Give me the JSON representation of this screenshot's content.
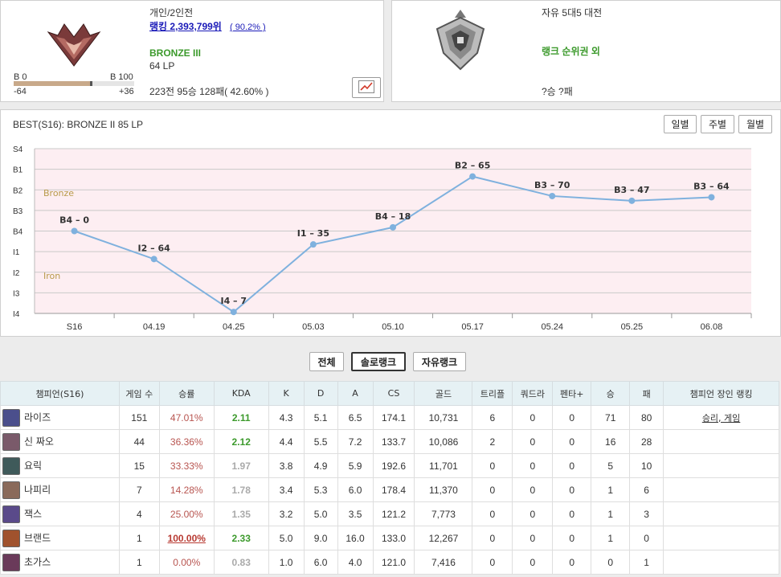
{
  "solo": {
    "queue_title": "개인/2인전",
    "ranking_text": "랭킹 2,393,799위",
    "ranking_pct": "( 90.2% )",
    "tier": "BRONZE III",
    "lp": "64 LP",
    "lp_left_label": "B 0",
    "lp_right_label": "B 100",
    "lp_min": "-64",
    "lp_max": "+36",
    "lp_progress": 0.64,
    "record": "223전 95승 128패( 42.60% )"
  },
  "flex": {
    "queue_title": "자유 5대5 대전",
    "status": "랭크 순위권 외",
    "record": "?승 ?패"
  },
  "graph": {
    "best_text": "BEST(S16): BRONZE II 85 LP",
    "period_buttons": [
      "일별",
      "주별",
      "월별"
    ],
    "bands": {
      "bronze": "Bronze",
      "iron": "Iron"
    }
  },
  "chart_data": {
    "type": "line",
    "y_ticks": [
      "S4",
      "B1",
      "B2",
      "B3",
      "B4",
      "I1",
      "I2",
      "I3",
      "I4"
    ],
    "x": [
      "S16",
      "04.19",
      "04.25",
      "05.03",
      "05.10",
      "05.17",
      "05.24",
      "05.25",
      "06.08"
    ],
    "values": [
      400,
      264,
      7,
      335,
      418,
      665,
      570,
      547,
      564
    ],
    "point_labels": [
      "B4 – 0",
      "I2 – 64",
      "I4 – 7",
      "I1 – 35",
      "B4 – 18",
      "B2 – 65",
      "B3 – 70",
      "B3 – 47",
      "B3 – 64"
    ],
    "line_color": "#7fb1de",
    "band_color": "#fdeef2"
  },
  "queue_buttons": [
    "전체",
    "솔로랭크",
    "자유랭크"
  ],
  "active_queue": "솔로랭크",
  "table": {
    "headers": [
      "챔피언(S16)",
      "게임 수",
      "승률",
      "KDA",
      "K",
      "D",
      "A",
      "CS",
      "골드",
      "트리플",
      "쿼드라",
      "펜타+",
      "승",
      "패",
      "챔피언 장인 랭킹"
    ],
    "rows": [
      {
        "name": "라이즈",
        "games": "151",
        "wr": "47.01%",
        "kda": "2.11",
        "k": "4.3",
        "d": "5.1",
        "a": "6.5",
        "cs": "174.1",
        "gold": "10,731",
        "triple": "6",
        "quadra": "0",
        "penta": "0",
        "w": "71",
        "l": "80",
        "mastery": "승리, 게임",
        "icon_color": "#4b4f8c"
      },
      {
        "name": "신 짜오",
        "games": "44",
        "wr": "36.36%",
        "kda": "2.12",
        "k": "4.4",
        "d": "5.5",
        "a": "7.2",
        "cs": "133.7",
        "gold": "10,086",
        "triple": "2",
        "quadra": "0",
        "penta": "0",
        "w": "16",
        "l": "28",
        "mastery": "",
        "icon_color": "#7a5a6a"
      },
      {
        "name": "요릭",
        "games": "15",
        "wr": "33.33%",
        "kda": "1.97",
        "k": "3.8",
        "d": "4.9",
        "a": "5.9",
        "cs": "192.6",
        "gold": "11,701",
        "triple": "0",
        "quadra": "0",
        "penta": "0",
        "w": "5",
        "l": "10",
        "mastery": "",
        "icon_color": "#3f5a5a"
      },
      {
        "name": "나피리",
        "games": "7",
        "wr": "14.28%",
        "kda": "1.78",
        "k": "3.4",
        "d": "5.3",
        "a": "6.0",
        "cs": "178.4",
        "gold": "11,370",
        "triple": "0",
        "quadra": "0",
        "penta": "0",
        "w": "1",
        "l": "6",
        "mastery": "",
        "icon_color": "#8a6a5a"
      },
      {
        "name": "잭스",
        "games": "4",
        "wr": "25.00%",
        "kda": "1.35",
        "k": "3.2",
        "d": "5.0",
        "a": "3.5",
        "cs": "121.2",
        "gold": "7,773",
        "triple": "0",
        "quadra": "0",
        "penta": "0",
        "w": "1",
        "l": "3",
        "mastery": "",
        "icon_color": "#5a4a8a"
      },
      {
        "name": "브랜드",
        "games": "1",
        "wr": "100.00%",
        "kda": "2.33",
        "k": "5.0",
        "d": "9.0",
        "a": "16.0",
        "cs": "133.0",
        "gold": "12,267",
        "triple": "0",
        "quadra": "0",
        "penta": "0",
        "w": "1",
        "l": "0",
        "mastery": "",
        "icon_color": "#a0522d"
      },
      {
        "name": "초가스",
        "games": "1",
        "wr": "0.00%",
        "kda": "0.83",
        "k": "1.0",
        "d": "6.0",
        "a": "4.0",
        "cs": "121.0",
        "gold": "7,416",
        "triple": "0",
        "quadra": "0",
        "penta": "0",
        "w": "0",
        "l": "1",
        "mastery": "",
        "icon_color": "#6a3a5a"
      }
    ]
  }
}
